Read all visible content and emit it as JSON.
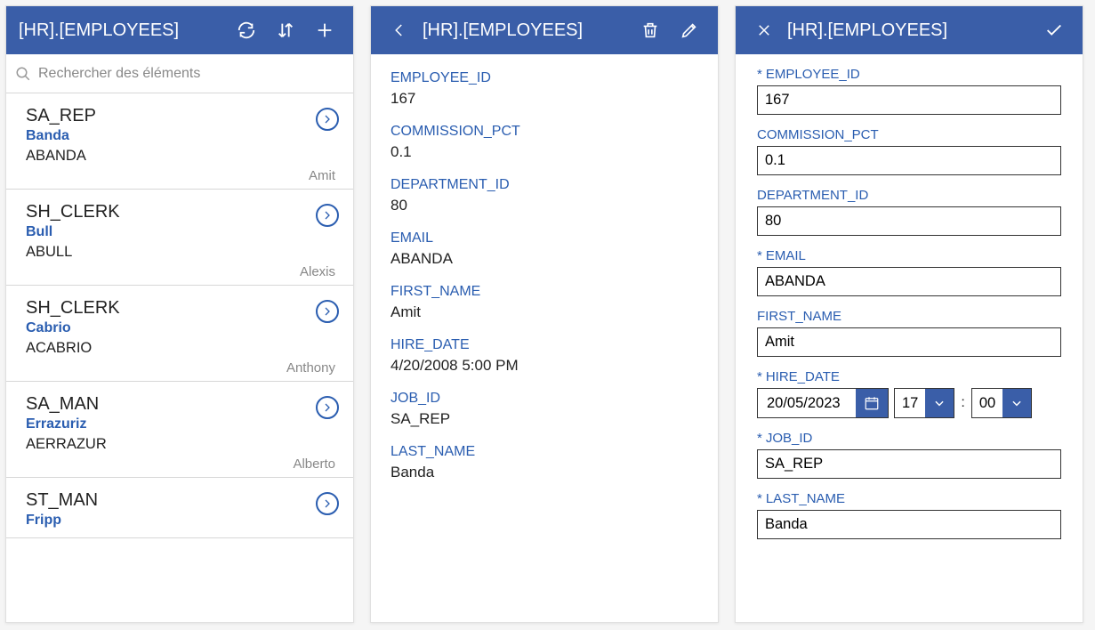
{
  "app_title": "[HR].[EMPLOYEES]",
  "search": {
    "placeholder": "Rechercher des éléments"
  },
  "list_items": [
    {
      "job": "SA_REP",
      "last": "Banda",
      "email": "ABANDA",
      "first": "Amit"
    },
    {
      "job": "SH_CLERK",
      "last": "Bull",
      "email": "ABULL",
      "first": "Alexis"
    },
    {
      "job": "SH_CLERK",
      "last": "Cabrio",
      "email": "ACABRIO",
      "first": "Anthony"
    },
    {
      "job": "SA_MAN",
      "last": "Errazuriz",
      "email": "AERRAZUR",
      "first": "Alberto"
    },
    {
      "job": "ST_MAN",
      "last": "Fripp",
      "email": "",
      "first": ""
    }
  ],
  "detail": {
    "fields": [
      {
        "label": "EMPLOYEE_ID",
        "value": "167"
      },
      {
        "label": "COMMISSION_PCT",
        "value": "0.1"
      },
      {
        "label": "DEPARTMENT_ID",
        "value": "80"
      },
      {
        "label": "EMAIL",
        "value": "ABANDA"
      },
      {
        "label": "FIRST_NAME",
        "value": "Amit"
      },
      {
        "label": "HIRE_DATE",
        "value": "4/20/2008 5:00 PM"
      },
      {
        "label": "JOB_ID",
        "value": "SA_REP"
      },
      {
        "label": "LAST_NAME",
        "value": "Banda"
      }
    ]
  },
  "edit": {
    "fields": [
      {
        "label": "EMPLOYEE_ID",
        "value": "167",
        "required": true,
        "type": "text"
      },
      {
        "label": "COMMISSION_PCT",
        "value": "0.1",
        "required": false,
        "type": "text"
      },
      {
        "label": "DEPARTMENT_ID",
        "value": "80",
        "required": false,
        "type": "text"
      },
      {
        "label": "EMAIL",
        "value": "ABANDA",
        "required": true,
        "type": "text"
      },
      {
        "label": "FIRST_NAME",
        "value": "Amit",
        "required": false,
        "type": "text"
      },
      {
        "label": "HIRE_DATE",
        "value": "20/05/2023",
        "hour": "17",
        "min": "00",
        "required": true,
        "type": "datetime"
      },
      {
        "label": "JOB_ID",
        "value": "SA_REP",
        "required": true,
        "type": "text"
      },
      {
        "label": "LAST_NAME",
        "value": "Banda",
        "required": true,
        "type": "text"
      }
    ]
  }
}
